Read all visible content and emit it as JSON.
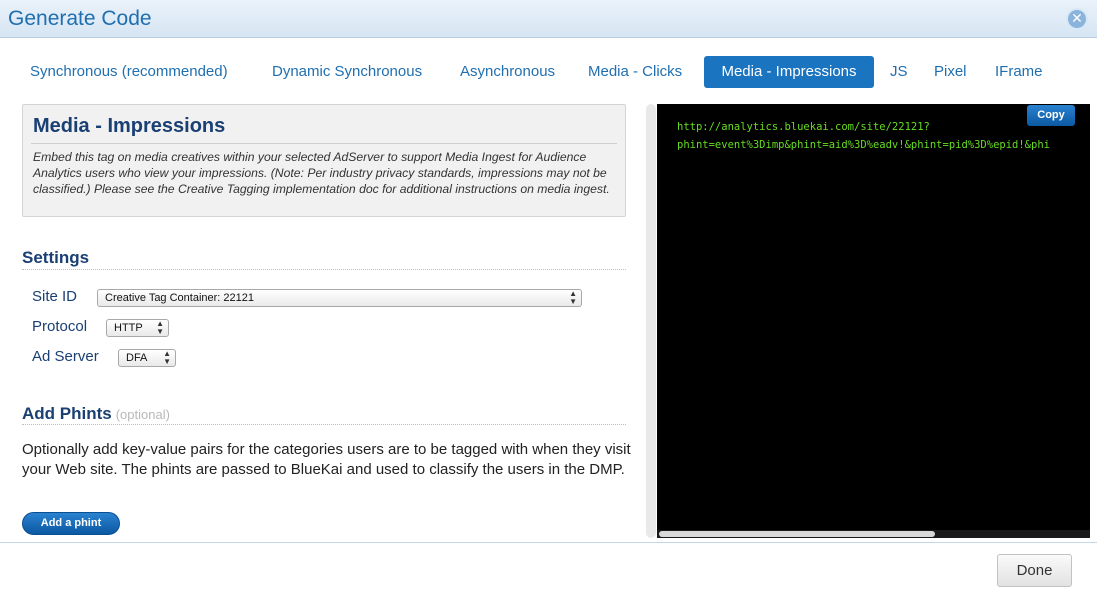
{
  "dialog": {
    "title": "Generate Code",
    "close_icon": "close-icon"
  },
  "tabs": [
    {
      "label": "Synchronous (recommended)",
      "active": false
    },
    {
      "label": "Dynamic Synchronous",
      "active": false
    },
    {
      "label": "Asynchronous",
      "active": false
    },
    {
      "label": "Media - Clicks",
      "active": false
    },
    {
      "label": "Media - Impressions",
      "active": true
    },
    {
      "label": "JS",
      "active": false
    },
    {
      "label": "Pixel",
      "active": false
    },
    {
      "label": "IFrame",
      "active": false
    }
  ],
  "info": {
    "heading": "Media - Impressions",
    "text": "Embed this tag on media creatives within your selected AdServer to support Media Ingest for Audience Analytics users who view your impressions. (Note: Per industry privacy standards, impressions may not be classified.) Please see the Creative Tagging implementation doc for additional instructions on media ingest."
  },
  "settings": {
    "title": "Settings",
    "site_id_label": "Site ID",
    "site_id_value": "Creative Tag Container: 22121",
    "protocol_label": "Protocol",
    "protocol_value": "HTTP",
    "ad_server_label": "Ad Server",
    "ad_server_value": "DFA"
  },
  "phints": {
    "title": "Add Phints",
    "optional": "(optional)",
    "description": "Optionally add key-value pairs for the categories users are to be tagged with when they visit your Web site. The phints are passed to BlueKai and used to classify the users in the DMP.",
    "add_button": "Add a phint"
  },
  "code": {
    "line1": "http://analytics.bluekai.com/site/22121?",
    "line2": "phint=event%3Dimp&phint=aid%3D%eadv!&phint=pid%3D%epid!&phi",
    "copy_label": "Copy"
  },
  "footer": {
    "done_label": "Done"
  },
  "colors": {
    "accent": "#1a74c0",
    "heading": "#1a3f73",
    "code_text": "#66dd22",
    "code_bg": "#000000"
  }
}
